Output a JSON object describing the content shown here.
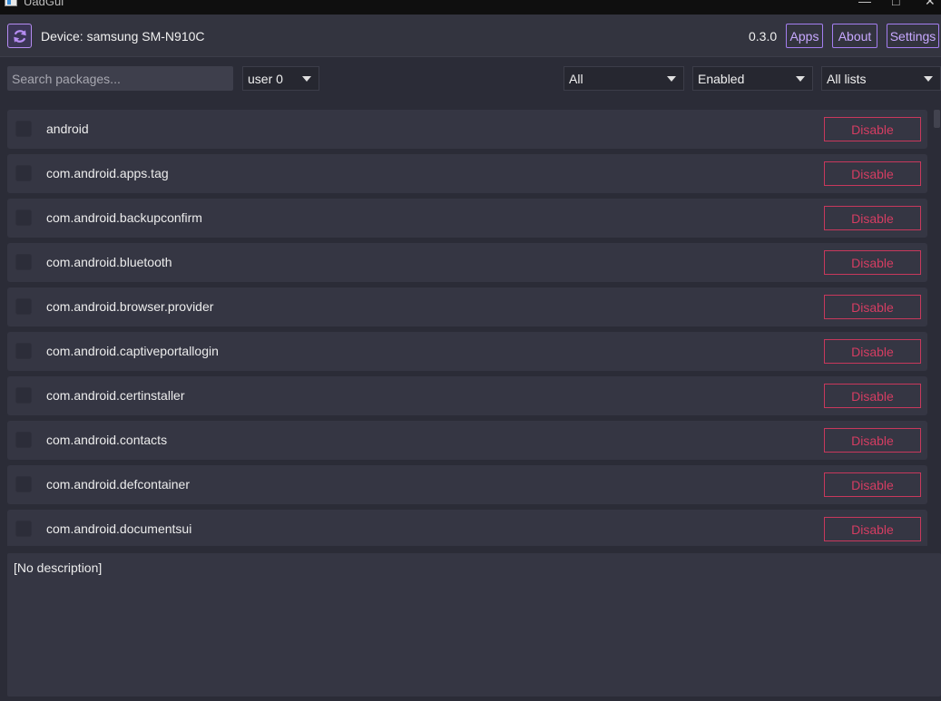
{
  "window": {
    "title": "UadGui"
  },
  "header": {
    "device_label": "Device: samsung SM-N910C",
    "version": "0.3.0",
    "nav": {
      "apps": "Apps",
      "about": "About",
      "settings": "Settings"
    }
  },
  "filters": {
    "search_placeholder": "Search packages...",
    "user": "user 0",
    "category": "All",
    "state": "Enabled",
    "lists": "All lists"
  },
  "packages": [
    {
      "name": "android",
      "action": "Disable"
    },
    {
      "name": "com.android.apps.tag",
      "action": "Disable"
    },
    {
      "name": "com.android.backupconfirm",
      "action": "Disable"
    },
    {
      "name": "com.android.bluetooth",
      "action": "Disable"
    },
    {
      "name": "com.android.browser.provider",
      "action": "Disable"
    },
    {
      "name": "com.android.captiveportallogin",
      "action": "Disable"
    },
    {
      "name": "com.android.certinstaller",
      "action": "Disable"
    },
    {
      "name": "com.android.contacts",
      "action": "Disable"
    },
    {
      "name": "com.android.defcontainer",
      "action": "Disable"
    },
    {
      "name": "com.android.documentsui",
      "action": "Disable"
    }
  ],
  "description": {
    "text": "[No description]"
  },
  "colors": {
    "accent": "#a47ef0",
    "danger": "#d43d62",
    "background": "#2b2c37",
    "row": "#353643"
  }
}
